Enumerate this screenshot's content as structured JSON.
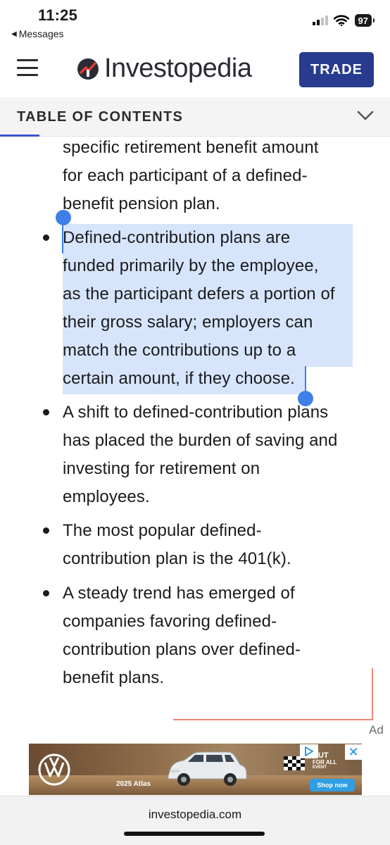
{
  "status_bar": {
    "time": "11:25",
    "back_app": "Messages",
    "battery": "97",
    "icons": [
      "signal-icon",
      "wifi-icon",
      "battery-icon"
    ]
  },
  "header": {
    "logo_text": "Investopedia",
    "trade_label": "TRADE",
    "menu_icon": "hamburger-icon",
    "brand_color": "#283b8f"
  },
  "toc": {
    "label": "TABLE OF CONTENTS",
    "accent": "#3a56d0",
    "icon": "chevron-down-icon"
  },
  "article": {
    "intro_lines": [
      "specific retirement benefit amount",
      "for each participant of a defined-",
      "benefit pension plan."
    ],
    "bullets": [
      {
        "lines": [
          "Defined-contribution plans are",
          "funded primarily by the employee,",
          "as the participant defers a portion of",
          "their gross salary; employers can",
          "match the contributions up to a",
          "certain amount, if they choose."
        ],
        "selected": true
      },
      {
        "lines": [
          "A shift to defined-contribution plans",
          "has placed the burden of saving and",
          "investing for retirement on",
          "employees."
        ]
      },
      {
        "lines": [
          "The most popular defined-",
          "contribution plan is the 401(k)."
        ]
      },
      {
        "lines": [
          "A steady trend has emerged of",
          "companies favoring defined-",
          "contribution plans over defined-",
          "benefit plans."
        ]
      }
    ],
    "selection_color": "#d6e5fb"
  },
  "ad": {
    "label": "Ad",
    "model": "2025 Atlas",
    "headline_1": "AUT",
    "headline_2": "FOR ALL",
    "headline_3": "EVENT",
    "cta": "Shop now",
    "close": "✕"
  },
  "browser": {
    "url": "investopedia.com"
  }
}
